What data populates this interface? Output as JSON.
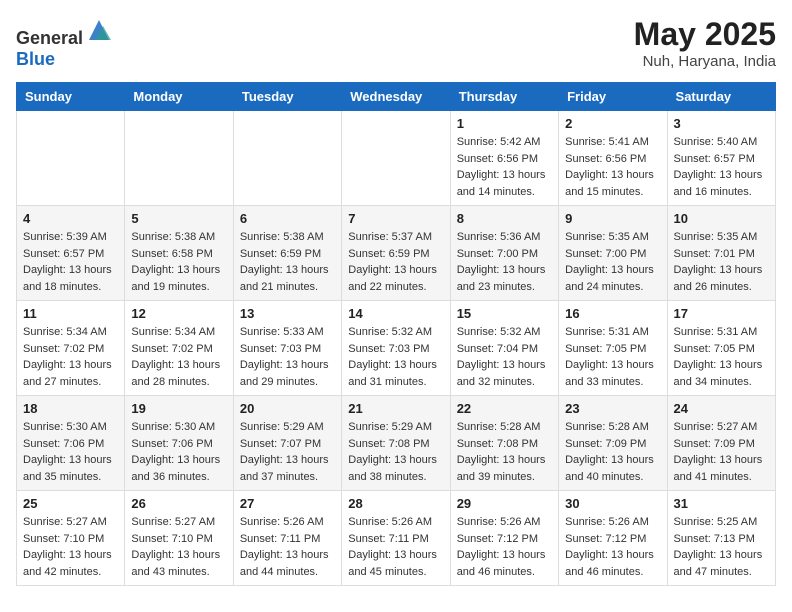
{
  "header": {
    "logo_general": "General",
    "logo_blue": "Blue",
    "title": "May 2025",
    "subtitle": "Nuh, Haryana, India"
  },
  "days_of_week": [
    "Sunday",
    "Monday",
    "Tuesday",
    "Wednesday",
    "Thursday",
    "Friday",
    "Saturday"
  ],
  "weeks": [
    [
      {
        "day": "",
        "info": ""
      },
      {
        "day": "",
        "info": ""
      },
      {
        "day": "",
        "info": ""
      },
      {
        "day": "",
        "info": ""
      },
      {
        "day": "1",
        "info": "Sunrise: 5:42 AM\nSunset: 6:56 PM\nDaylight: 13 hours\nand 14 minutes."
      },
      {
        "day": "2",
        "info": "Sunrise: 5:41 AM\nSunset: 6:56 PM\nDaylight: 13 hours\nand 15 minutes."
      },
      {
        "day": "3",
        "info": "Sunrise: 5:40 AM\nSunset: 6:57 PM\nDaylight: 13 hours\nand 16 minutes."
      }
    ],
    [
      {
        "day": "4",
        "info": "Sunrise: 5:39 AM\nSunset: 6:57 PM\nDaylight: 13 hours\nand 18 minutes."
      },
      {
        "day": "5",
        "info": "Sunrise: 5:38 AM\nSunset: 6:58 PM\nDaylight: 13 hours\nand 19 minutes."
      },
      {
        "day": "6",
        "info": "Sunrise: 5:38 AM\nSunset: 6:59 PM\nDaylight: 13 hours\nand 21 minutes."
      },
      {
        "day": "7",
        "info": "Sunrise: 5:37 AM\nSunset: 6:59 PM\nDaylight: 13 hours\nand 22 minutes."
      },
      {
        "day": "8",
        "info": "Sunrise: 5:36 AM\nSunset: 7:00 PM\nDaylight: 13 hours\nand 23 minutes."
      },
      {
        "day": "9",
        "info": "Sunrise: 5:35 AM\nSunset: 7:00 PM\nDaylight: 13 hours\nand 24 minutes."
      },
      {
        "day": "10",
        "info": "Sunrise: 5:35 AM\nSunset: 7:01 PM\nDaylight: 13 hours\nand 26 minutes."
      }
    ],
    [
      {
        "day": "11",
        "info": "Sunrise: 5:34 AM\nSunset: 7:02 PM\nDaylight: 13 hours\nand 27 minutes."
      },
      {
        "day": "12",
        "info": "Sunrise: 5:34 AM\nSunset: 7:02 PM\nDaylight: 13 hours\nand 28 minutes."
      },
      {
        "day": "13",
        "info": "Sunrise: 5:33 AM\nSunset: 7:03 PM\nDaylight: 13 hours\nand 29 minutes."
      },
      {
        "day": "14",
        "info": "Sunrise: 5:32 AM\nSunset: 7:03 PM\nDaylight: 13 hours\nand 31 minutes."
      },
      {
        "day": "15",
        "info": "Sunrise: 5:32 AM\nSunset: 7:04 PM\nDaylight: 13 hours\nand 32 minutes."
      },
      {
        "day": "16",
        "info": "Sunrise: 5:31 AM\nSunset: 7:05 PM\nDaylight: 13 hours\nand 33 minutes."
      },
      {
        "day": "17",
        "info": "Sunrise: 5:31 AM\nSunset: 7:05 PM\nDaylight: 13 hours\nand 34 minutes."
      }
    ],
    [
      {
        "day": "18",
        "info": "Sunrise: 5:30 AM\nSunset: 7:06 PM\nDaylight: 13 hours\nand 35 minutes."
      },
      {
        "day": "19",
        "info": "Sunrise: 5:30 AM\nSunset: 7:06 PM\nDaylight: 13 hours\nand 36 minutes."
      },
      {
        "day": "20",
        "info": "Sunrise: 5:29 AM\nSunset: 7:07 PM\nDaylight: 13 hours\nand 37 minutes."
      },
      {
        "day": "21",
        "info": "Sunrise: 5:29 AM\nSunset: 7:08 PM\nDaylight: 13 hours\nand 38 minutes."
      },
      {
        "day": "22",
        "info": "Sunrise: 5:28 AM\nSunset: 7:08 PM\nDaylight: 13 hours\nand 39 minutes."
      },
      {
        "day": "23",
        "info": "Sunrise: 5:28 AM\nSunset: 7:09 PM\nDaylight: 13 hours\nand 40 minutes."
      },
      {
        "day": "24",
        "info": "Sunrise: 5:27 AM\nSunset: 7:09 PM\nDaylight: 13 hours\nand 41 minutes."
      }
    ],
    [
      {
        "day": "25",
        "info": "Sunrise: 5:27 AM\nSunset: 7:10 PM\nDaylight: 13 hours\nand 42 minutes."
      },
      {
        "day": "26",
        "info": "Sunrise: 5:27 AM\nSunset: 7:10 PM\nDaylight: 13 hours\nand 43 minutes."
      },
      {
        "day": "27",
        "info": "Sunrise: 5:26 AM\nSunset: 7:11 PM\nDaylight: 13 hours\nand 44 minutes."
      },
      {
        "day": "28",
        "info": "Sunrise: 5:26 AM\nSunset: 7:11 PM\nDaylight: 13 hours\nand 45 minutes."
      },
      {
        "day": "29",
        "info": "Sunrise: 5:26 AM\nSunset: 7:12 PM\nDaylight: 13 hours\nand 46 minutes."
      },
      {
        "day": "30",
        "info": "Sunrise: 5:26 AM\nSunset: 7:12 PM\nDaylight: 13 hours\nand 46 minutes."
      },
      {
        "day": "31",
        "info": "Sunrise: 5:25 AM\nSunset: 7:13 PM\nDaylight: 13 hours\nand 47 minutes."
      }
    ]
  ]
}
